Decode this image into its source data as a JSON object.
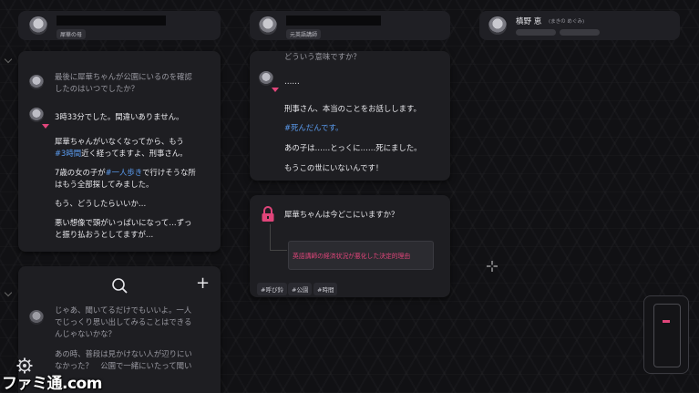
{
  "col1": {
    "tag": "犀華の母",
    "messages": [
      "最後に犀華ちゃんが公園にいるのを確認",
      "したのはいつでしたか？",
      "3時33分でした。間違いありません。",
      "犀華ちゃんがいなくなってから、もう",
      "#3時間",
      "近く経ってますよ、刑事さん。",
      "7歳の女の子が",
      "#一人歩き",
      "で行けそうな所",
      "はもう全部探してみました。",
      "もう、どうしたらいいか…",
      "悪い想像で頭がいっぱいになって…ずっ",
      "と振り払おうとしてますが…"
    ],
    "lower_messages": [
      "じゃあ、聞いてるだけでもいいよ。一人",
      "でじっくり思い出してみることはできる",
      "んじゃないかな？",
      "あの時、普段は見かけない人が辺りにい",
      "なかった？　公園で一緒にいたって聞い"
    ],
    "plus": "+"
  },
  "col2": {
    "tag": "元英語講師",
    "top_cut": "どういう意味ですか？",
    "dots": "……",
    "messages": [
      "刑事さん、本当のことをお話しします。",
      "#死んだんです。",
      "あの子は……とっくに……死にました。",
      "もうこの世にいないんです！"
    ],
    "question": "犀華ちゃんは今どこにいますか？",
    "link": "英語講師の経済状況が悪化した決定的理由",
    "chips": [
      "#呼び鈴",
      "#公園",
      "#時間"
    ]
  },
  "col3": {
    "name": "槙野 恵",
    "furigana": "(まきの めぐみ)"
  },
  "watermark": "ファミ通.com"
}
